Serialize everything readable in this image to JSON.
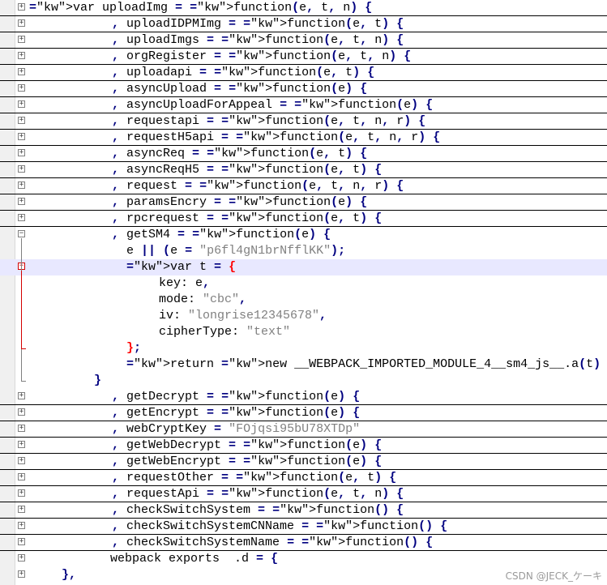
{
  "editor": {
    "lines": [
      "var uploadImg = function(e, t, n) {",
      ", uploadIDPMImg = function(e, t) {",
      ", uploadImgs = function(e, t, n) {",
      ", orgRegister = function(e, t, n) {",
      ", uploadapi = function(e, t) {",
      ", asyncUpload = function(e) {",
      ", asyncUploadForAppeal = function(e) {",
      ", requestapi = function(e, t, n, r) {",
      ", requestH5api = function(e, t, n, r) {",
      ", asyncReq = function(e, t) {",
      ", asyncReqH5 = function(e, t) {",
      ", request = function(e, t, n, r) {",
      ", paramsEncry = function(e) {",
      ", rpcrequest = function(e, t) {",
      ", getSM4 = function(e) {",
      "e || (e = \"p6fl4gN1brNfflKK\");",
      "var t = {",
      "key: e,",
      "mode: \"cbc\",",
      "iv: \"longrise12345678\",",
      "cipherType: \"text\"",
      "};",
      "return new __WEBPACK_IMPORTED_MODULE_4__sm4_js__.a(t)",
      "}",
      ", getDecrypt = function(e) {",
      ", getEncrypt = function(e) {",
      ", webCryptKey = \"FOjqsi95bU78XTDp\"",
      ", getWebDecrypt = function(e) {",
      ", getWebEncrypt = function(e) {",
      ", requestOther = function(e, t) {",
      ", requestApi = function(e, t, n) {",
      ", checkSwitchSystem = function() {",
      ", checkSwitchSystemCNName = function() {",
      ", checkSwitchSystemName = function() {",
      "webpack exports  .d = {",
      "},"
    ]
  },
  "watermark": "CSDN @JECK_ケーキ"
}
